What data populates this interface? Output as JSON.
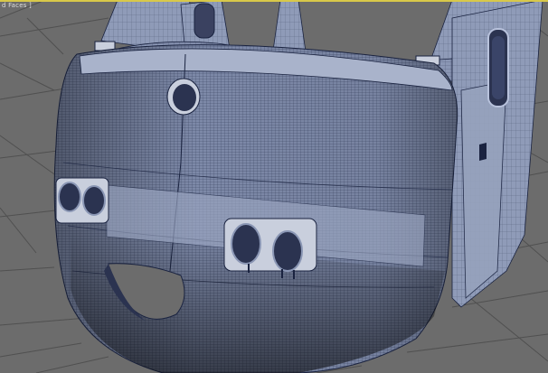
{
  "viewport": {
    "label": "d Faces ]",
    "active_border_color": "#d8c84a",
    "background_color": "#6c6c6c",
    "grid_color": "#505050",
    "wire_color": "#1a2340"
  },
  "model": {
    "shaded_color": "#8a96b4",
    "dark_color": "#2b3350",
    "highlight_color": "#b8c2dc"
  }
}
